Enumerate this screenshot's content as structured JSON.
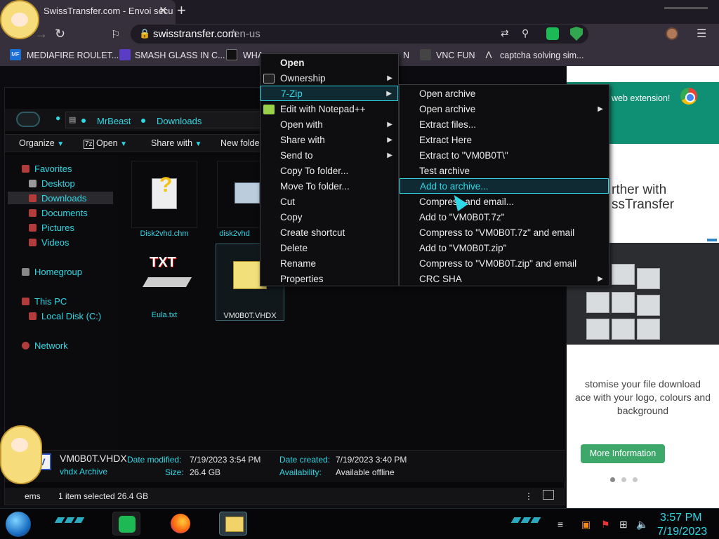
{
  "browser": {
    "tab_title": "SwissTransfer.com - Envoi sécu",
    "tab_close": "✕",
    "new_tab": "+",
    "url_host": "swisstransfer.com",
    "url_path": "/en-us",
    "bookmarks": [
      {
        "label": "MEDIAFIRE ROULET...",
        "icon": "MF"
      },
      {
        "label": "SMASH GLASS IN C..."
      },
      {
        "label": "WHA"
      },
      {
        "label": "N"
      },
      {
        "label": "VNC FUN"
      },
      {
        "label": "captcha solving sim..."
      }
    ]
  },
  "webpage": {
    "extension_text": "web extension!",
    "headline": "rther with\nssTransfer",
    "description": "stomise your file download\nace with your logo, colours and\nbackground",
    "more_info": "More Information"
  },
  "explorer": {
    "breadcrumbs": [
      "MrBeast",
      "Downloads"
    ],
    "commands": {
      "organize": "Organize",
      "open": "Open",
      "share_with": "Share with",
      "new_folder": "New folde"
    },
    "nav": {
      "favorites": "Favorites",
      "desktop": "Desktop",
      "downloads": "Downloads",
      "documents": "Documents",
      "pictures": "Pictures",
      "videos": "Videos",
      "homegroup": "Homegroup",
      "this_pc": "This PC",
      "local_disk": "Local Disk (C:)",
      "network": "Network"
    },
    "files": [
      {
        "name": "Disk2vhd.chm"
      },
      {
        "name": "disk2vhd"
      },
      {
        "name": "Eula.txt"
      },
      {
        "name": "VM0B0T.VHDX"
      }
    ],
    "details": {
      "name": "VM0B0T.VHDX",
      "type": "vhdx Archive",
      "date_modified_label": "Date modified:",
      "date_modified": "7/19/2023 3:54 PM",
      "size_label": "Size:",
      "size": "26.4 GB",
      "date_created_label": "Date created:",
      "date_created": "7/19/2023 3:40 PM",
      "availability_label": "Availability:",
      "availability": "Available offline"
    },
    "status": {
      "items": "ems",
      "selected": "1 item selected  26.4 GB"
    }
  },
  "context_menu": {
    "items": [
      {
        "label": "Open",
        "bold": true
      },
      {
        "label": "Ownership",
        "submenu": true
      },
      {
        "label": "7-Zip",
        "submenu": true,
        "highlighted": true
      },
      {
        "label": "Edit with Notepad++"
      },
      {
        "label": "Open with",
        "submenu": true
      },
      {
        "label": "Share with",
        "submenu": true
      },
      {
        "label": "Send to",
        "submenu": true
      },
      {
        "label": "Copy To folder..."
      },
      {
        "label": "Move To folder..."
      },
      {
        "label": "Cut"
      },
      {
        "label": "Copy"
      },
      {
        "label": "Create shortcut"
      },
      {
        "label": "Delete"
      },
      {
        "label": "Rename"
      },
      {
        "label": "Properties"
      }
    ]
  },
  "zip_menu": {
    "items": [
      {
        "label": "Open archive"
      },
      {
        "label": "Open archive",
        "submenu": true
      },
      {
        "label": "Extract files..."
      },
      {
        "label": "Extract Here"
      },
      {
        "label": "Extract to \"VM0B0T\\\""
      },
      {
        "label": "Test archive"
      },
      {
        "label": "Add to archive...",
        "highlighted": true
      },
      {
        "label": "Compress and email..."
      },
      {
        "label": "Add to \"VM0B0T.7z\""
      },
      {
        "label": "Compress to \"VM0B0T.7z\" and email"
      },
      {
        "label": "Add to \"VM0B0T.zip\""
      },
      {
        "label": "Compress to \"VM0B0T.zip\" and email"
      },
      {
        "label": "CRC SHA",
        "submenu": true
      }
    ]
  },
  "taskbar": {
    "time": "3:57 PM",
    "date": "7/19/2023"
  },
  "colors": {
    "accent": "#2ed8e6",
    "menu_bg": "#0e0e10",
    "highlight_border": "#2ed8e6"
  }
}
